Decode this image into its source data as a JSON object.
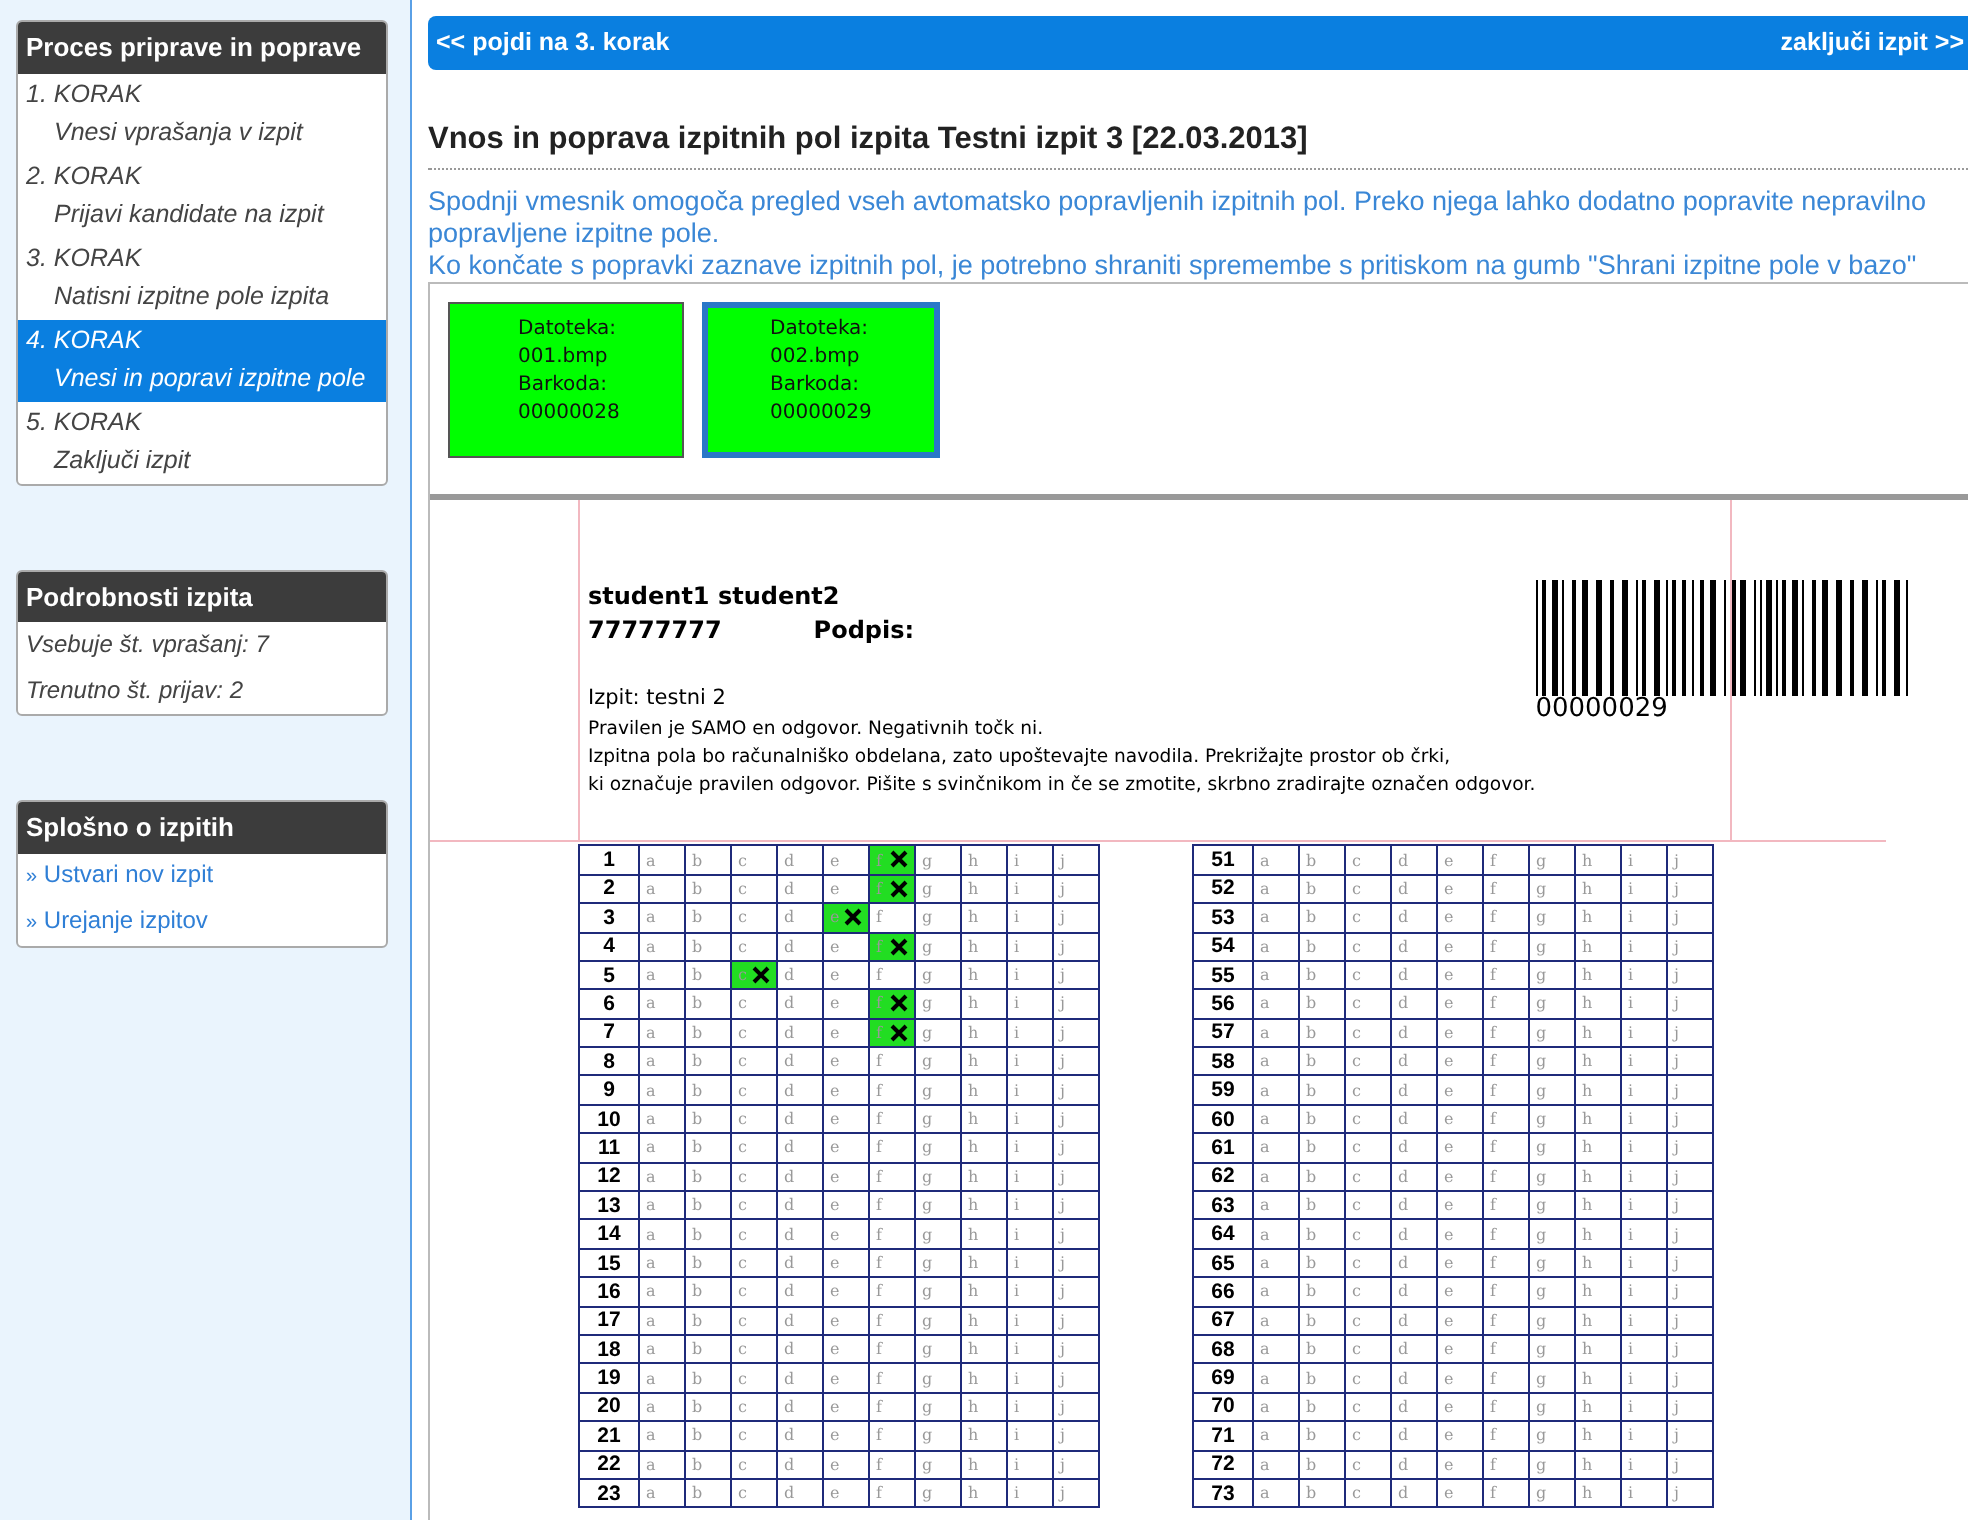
{
  "sidebar": {
    "panels": [
      {
        "kind": "steps",
        "title": "Proces priprave in poprave",
        "items": [
          {
            "step": "1. KORAK",
            "label": "Vnesi vprašanja v izpit",
            "selected": false
          },
          {
            "step": "2. KORAK",
            "label": "Prijavi kandidate na izpit",
            "selected": false
          },
          {
            "step": "3. KORAK",
            "label": "Natisni izpitne pole izpita",
            "selected": false
          },
          {
            "step": "4. KORAK",
            "label": "Vnesi in popravi izpitne pole",
            "selected": true
          },
          {
            "step": "5. KORAK",
            "label": "Zaključi izpit",
            "selected": false
          }
        ]
      },
      {
        "kind": "info",
        "title": "Podrobnosti izpita",
        "items": [
          {
            "label": "Vsebuje št. vprašanj: 7"
          },
          {
            "label": "Trenutno št. prijav: 2"
          }
        ]
      },
      {
        "kind": "links",
        "title": "Splošno o izpitih",
        "items": [
          {
            "bullet": "»",
            "label": "Ustvari nov izpit"
          },
          {
            "bullet": "»",
            "label": "Urejanje izpitov"
          }
        ]
      }
    ]
  },
  "nav_bar": {
    "back": "<< pojdi na 3. korak",
    "forward": "zaključi izpit >>"
  },
  "heading": "Vnos in poprava izpitnih pol izpita Testni izpit 3 [22.03.2013]",
  "description": [
    "Spodnji vmesnik omogoča pregled vseh avtomatsko popravljenih izpitnih pol. Preko njega lahko dodatno popravite nepravilno popravljene izpitne pole.",
    "Ko končate s popravki zaznave izpitnih pol, je potrebno shraniti spremembe s pritiskom na gumb \"Shrani izpitne pole v bazo\""
  ],
  "sheets": [
    {
      "lines": [
        "Datoteka:",
        "001.bmp",
        "Barkoda:",
        "00000028"
      ],
      "selected": false
    },
    {
      "lines": [
        "Datoteka:",
        "002.bmp",
        "Barkoda:",
        "00000029"
      ],
      "selected": true
    }
  ],
  "scan": {
    "student": "student1 student2",
    "student_id": "77777777",
    "signature_label": "Podpis:",
    "exam": "Izpit: testni 2",
    "instructions": [
      "Pravilen je SAMO en odgovor. Negativnih točk ni.",
      "Izpitna pola bo računalniško obdelana, zato upoštevajte navodila. Prekrižajte prostor ob črki,",
      "ki označuje pravilen odgovor. Pišite s svinčnikom in če se zmotite, skrbno zradirajte označen odgovor."
    ],
    "barcode": "00000029",
    "grids": [
      {
        "rows": [
          {
            "number": "1",
            "options": [
              "a",
              "b",
              "c",
              "d",
              "e",
              "f",
              "g",
              "h",
              "i",
              "j"
            ],
            "crossed": [
              false,
              false,
              false,
              false,
              false,
              true,
              false,
              false,
              false,
              false
            ]
          },
          {
            "number": "2",
            "options": [
              "a",
              "b",
              "c",
              "d",
              "e",
              "f",
              "g",
              "h",
              "i",
              "j"
            ],
            "crossed": [
              false,
              false,
              false,
              false,
              false,
              true,
              false,
              false,
              false,
              false
            ]
          },
          {
            "number": "3",
            "options": [
              "a",
              "b",
              "c",
              "d",
              "e",
              "f",
              "g",
              "h",
              "i",
              "j"
            ],
            "crossed": [
              false,
              false,
              false,
              false,
              true,
              false,
              false,
              false,
              false,
              false
            ]
          },
          {
            "number": "4",
            "options": [
              "a",
              "b",
              "c",
              "d",
              "e",
              "f",
              "g",
              "h",
              "i",
              "j"
            ],
            "crossed": [
              false,
              false,
              false,
              false,
              false,
              true,
              false,
              false,
              false,
              false
            ]
          },
          {
            "number": "5",
            "options": [
              "a",
              "b",
              "c",
              "d",
              "e",
              "f",
              "g",
              "h",
              "i",
              "j"
            ],
            "crossed": [
              false,
              false,
              true,
              false,
              false,
              false,
              false,
              false,
              false,
              false
            ]
          },
          {
            "number": "6",
            "options": [
              "a",
              "b",
              "c",
              "d",
              "e",
              "f",
              "g",
              "h",
              "i",
              "j"
            ],
            "crossed": [
              false,
              false,
              false,
              false,
              false,
              true,
              false,
              false,
              false,
              false
            ]
          },
          {
            "number": "7",
            "options": [
              "a",
              "b",
              "c",
              "d",
              "e",
              "f",
              "g",
              "h",
              "i",
              "j"
            ],
            "crossed": [
              false,
              false,
              false,
              false,
              false,
              true,
              false,
              false,
              false,
              false
            ]
          },
          {
            "number": "8",
            "options": [
              "a",
              "b",
              "c",
              "d",
              "e",
              "f",
              "g",
              "h",
              "i",
              "j"
            ],
            "crossed": [
              false,
              false,
              false,
              false,
              false,
              false,
              false,
              false,
              false,
              false
            ]
          },
          {
            "number": "9",
            "options": [
              "a",
              "b",
              "c",
              "d",
              "e",
              "f",
              "g",
              "h",
              "i",
              "j"
            ],
            "crossed": [
              false,
              false,
              false,
              false,
              false,
              false,
              false,
              false,
              false,
              false
            ]
          },
          {
            "number": "10",
            "options": [
              "a",
              "b",
              "c",
              "d",
              "e",
              "f",
              "g",
              "h",
              "i",
              "j"
            ],
            "crossed": [
              false,
              false,
              false,
              false,
              false,
              false,
              false,
              false,
              false,
              false
            ]
          },
          {
            "number": "11",
            "options": [
              "a",
              "b",
              "c",
              "d",
              "e",
              "f",
              "g",
              "h",
              "i",
              "j"
            ],
            "crossed": [
              false,
              false,
              false,
              false,
              false,
              false,
              false,
              false,
              false,
              false
            ]
          },
          {
            "number": "12",
            "options": [
              "a",
              "b",
              "c",
              "d",
              "e",
              "f",
              "g",
              "h",
              "i",
              "j"
            ],
            "crossed": [
              false,
              false,
              false,
              false,
              false,
              false,
              false,
              false,
              false,
              false
            ]
          },
          {
            "number": "13",
            "options": [
              "a",
              "b",
              "c",
              "d",
              "e",
              "f",
              "g",
              "h",
              "i",
              "j"
            ],
            "crossed": [
              false,
              false,
              false,
              false,
              false,
              false,
              false,
              false,
              false,
              false
            ]
          },
          {
            "number": "14",
            "options": [
              "a",
              "b",
              "c",
              "d",
              "e",
              "f",
              "g",
              "h",
              "i",
              "j"
            ],
            "crossed": [
              false,
              false,
              false,
              false,
              false,
              false,
              false,
              false,
              false,
              false
            ]
          },
          {
            "number": "15",
            "options": [
              "a",
              "b",
              "c",
              "d",
              "e",
              "f",
              "g",
              "h",
              "i",
              "j"
            ],
            "crossed": [
              false,
              false,
              false,
              false,
              false,
              false,
              false,
              false,
              false,
              false
            ]
          },
          {
            "number": "16",
            "options": [
              "a",
              "b",
              "c",
              "d",
              "e",
              "f",
              "g",
              "h",
              "i",
              "j"
            ],
            "crossed": [
              false,
              false,
              false,
              false,
              false,
              false,
              false,
              false,
              false,
              false
            ]
          },
          {
            "number": "17",
            "options": [
              "a",
              "b",
              "c",
              "d",
              "e",
              "f",
              "g",
              "h",
              "i",
              "j"
            ],
            "crossed": [
              false,
              false,
              false,
              false,
              false,
              false,
              false,
              false,
              false,
              false
            ]
          },
          {
            "number": "18",
            "options": [
              "a",
              "b",
              "c",
              "d",
              "e",
              "f",
              "g",
              "h",
              "i",
              "j"
            ],
            "crossed": [
              false,
              false,
              false,
              false,
              false,
              false,
              false,
              false,
              false,
              false
            ]
          },
          {
            "number": "19",
            "options": [
              "a",
              "b",
              "c",
              "d",
              "e",
              "f",
              "g",
              "h",
              "i",
              "j"
            ],
            "crossed": [
              false,
              false,
              false,
              false,
              false,
              false,
              false,
              false,
              false,
              false
            ]
          },
          {
            "number": "20",
            "options": [
              "a",
              "b",
              "c",
              "d",
              "e",
              "f",
              "g",
              "h",
              "i",
              "j"
            ],
            "crossed": [
              false,
              false,
              false,
              false,
              false,
              false,
              false,
              false,
              false,
              false
            ]
          },
          {
            "number": "21",
            "options": [
              "a",
              "b",
              "c",
              "d",
              "e",
              "f",
              "g",
              "h",
              "i",
              "j"
            ],
            "crossed": [
              false,
              false,
              false,
              false,
              false,
              false,
              false,
              false,
              false,
              false
            ]
          },
          {
            "number": "22",
            "options": [
              "a",
              "b",
              "c",
              "d",
              "e",
              "f",
              "g",
              "h",
              "i",
              "j"
            ],
            "crossed": [
              false,
              false,
              false,
              false,
              false,
              false,
              false,
              false,
              false,
              false
            ]
          },
          {
            "number": "23",
            "options": [
              "a",
              "b",
              "c",
              "d",
              "e",
              "f",
              "g",
              "h",
              "i",
              "j"
            ],
            "crossed": [
              false,
              false,
              false,
              false,
              false,
              false,
              false,
              false,
              false,
              false
            ]
          }
        ]
      },
      {
        "rows": [
          {
            "number": "51",
            "options": [
              "a",
              "b",
              "c",
              "d",
              "e",
              "f",
              "g",
              "h",
              "i",
              "j"
            ],
            "crossed": [
              false,
              false,
              false,
              false,
              false,
              false,
              false,
              false,
              false,
              false
            ]
          },
          {
            "number": "52",
            "options": [
              "a",
              "b",
              "c",
              "d",
              "e",
              "f",
              "g",
              "h",
              "i",
              "j"
            ],
            "crossed": [
              false,
              false,
              false,
              false,
              false,
              false,
              false,
              false,
              false,
              false
            ]
          },
          {
            "number": "53",
            "options": [
              "a",
              "b",
              "c",
              "d",
              "e",
              "f",
              "g",
              "h",
              "i",
              "j"
            ],
            "crossed": [
              false,
              false,
              false,
              false,
              false,
              false,
              false,
              false,
              false,
              false
            ]
          },
          {
            "number": "54",
            "options": [
              "a",
              "b",
              "c",
              "d",
              "e",
              "f",
              "g",
              "h",
              "i",
              "j"
            ],
            "crossed": [
              false,
              false,
              false,
              false,
              false,
              false,
              false,
              false,
              false,
              false
            ]
          },
          {
            "number": "55",
            "options": [
              "a",
              "b",
              "c",
              "d",
              "e",
              "f",
              "g",
              "h",
              "i",
              "j"
            ],
            "crossed": [
              false,
              false,
              false,
              false,
              false,
              false,
              false,
              false,
              false,
              false
            ]
          },
          {
            "number": "56",
            "options": [
              "a",
              "b",
              "c",
              "d",
              "e",
              "f",
              "g",
              "h",
              "i",
              "j"
            ],
            "crossed": [
              false,
              false,
              false,
              false,
              false,
              false,
              false,
              false,
              false,
              false
            ]
          },
          {
            "number": "57",
            "options": [
              "a",
              "b",
              "c",
              "d",
              "e",
              "f",
              "g",
              "h",
              "i",
              "j"
            ],
            "crossed": [
              false,
              false,
              false,
              false,
              false,
              false,
              false,
              false,
              false,
              false
            ]
          },
          {
            "number": "58",
            "options": [
              "a",
              "b",
              "c",
              "d",
              "e",
              "f",
              "g",
              "h",
              "i",
              "j"
            ],
            "crossed": [
              false,
              false,
              false,
              false,
              false,
              false,
              false,
              false,
              false,
              false
            ]
          },
          {
            "number": "59",
            "options": [
              "a",
              "b",
              "c",
              "d",
              "e",
              "f",
              "g",
              "h",
              "i",
              "j"
            ],
            "crossed": [
              false,
              false,
              false,
              false,
              false,
              false,
              false,
              false,
              false,
              false
            ]
          },
          {
            "number": "60",
            "options": [
              "a",
              "b",
              "c",
              "d",
              "e",
              "f",
              "g",
              "h",
              "i",
              "j"
            ],
            "crossed": [
              false,
              false,
              false,
              false,
              false,
              false,
              false,
              false,
              false,
              false
            ]
          },
          {
            "number": "61",
            "options": [
              "a",
              "b",
              "c",
              "d",
              "e",
              "f",
              "g",
              "h",
              "i",
              "j"
            ],
            "crossed": [
              false,
              false,
              false,
              false,
              false,
              false,
              false,
              false,
              false,
              false
            ]
          },
          {
            "number": "62",
            "options": [
              "a",
              "b",
              "c",
              "d",
              "e",
              "f",
              "g",
              "h",
              "i",
              "j"
            ],
            "crossed": [
              false,
              false,
              false,
              false,
              false,
              false,
              false,
              false,
              false,
              false
            ]
          },
          {
            "number": "63",
            "options": [
              "a",
              "b",
              "c",
              "d",
              "e",
              "f",
              "g",
              "h",
              "i",
              "j"
            ],
            "crossed": [
              false,
              false,
              false,
              false,
              false,
              false,
              false,
              false,
              false,
              false
            ]
          },
          {
            "number": "64",
            "options": [
              "a",
              "b",
              "c",
              "d",
              "e",
              "f",
              "g",
              "h",
              "i",
              "j"
            ],
            "crossed": [
              false,
              false,
              false,
              false,
              false,
              false,
              false,
              false,
              false,
              false
            ]
          },
          {
            "number": "65",
            "options": [
              "a",
              "b",
              "c",
              "d",
              "e",
              "f",
              "g",
              "h",
              "i",
              "j"
            ],
            "crossed": [
              false,
              false,
              false,
              false,
              false,
              false,
              false,
              false,
              false,
              false
            ]
          },
          {
            "number": "66",
            "options": [
              "a",
              "b",
              "c",
              "d",
              "e",
              "f",
              "g",
              "h",
              "i",
              "j"
            ],
            "crossed": [
              false,
              false,
              false,
              false,
              false,
              false,
              false,
              false,
              false,
              false
            ]
          },
          {
            "number": "67",
            "options": [
              "a",
              "b",
              "c",
              "d",
              "e",
              "f",
              "g",
              "h",
              "i",
              "j"
            ],
            "crossed": [
              false,
              false,
              false,
              false,
              false,
              false,
              false,
              false,
              false,
              false
            ]
          },
          {
            "number": "68",
            "options": [
              "a",
              "b",
              "c",
              "d",
              "e",
              "f",
              "g",
              "h",
              "i",
              "j"
            ],
            "crossed": [
              false,
              false,
              false,
              false,
              false,
              false,
              false,
              false,
              false,
              false
            ]
          },
          {
            "number": "69",
            "options": [
              "a",
              "b",
              "c",
              "d",
              "e",
              "f",
              "g",
              "h",
              "i",
              "j"
            ],
            "crossed": [
              false,
              false,
              false,
              false,
              false,
              false,
              false,
              false,
              false,
              false
            ]
          },
          {
            "number": "70",
            "options": [
              "a",
              "b",
              "c",
              "d",
              "e",
              "f",
              "g",
              "h",
              "i",
              "j"
            ],
            "crossed": [
              false,
              false,
              false,
              false,
              false,
              false,
              false,
              false,
              false,
              false
            ]
          },
          {
            "number": "71",
            "options": [
              "a",
              "b",
              "c",
              "d",
              "e",
              "f",
              "g",
              "h",
              "i",
              "j"
            ],
            "crossed": [
              false,
              false,
              false,
              false,
              false,
              false,
              false,
              false,
              false,
              false
            ]
          },
          {
            "number": "72",
            "options": [
              "a",
              "b",
              "c",
              "d",
              "e",
              "f",
              "g",
              "h",
              "i",
              "j"
            ],
            "crossed": [
              false,
              false,
              false,
              false,
              false,
              false,
              false,
              false,
              false,
              false
            ]
          },
          {
            "number": "73",
            "options": [
              "a",
              "b",
              "c",
              "d",
              "e",
              "f",
              "g",
              "h",
              "i",
              "j"
            ],
            "crossed": [
              false,
              false,
              false,
              false,
              false,
              false,
              false,
              false,
              false,
              false
            ]
          }
        ]
      }
    ]
  }
}
